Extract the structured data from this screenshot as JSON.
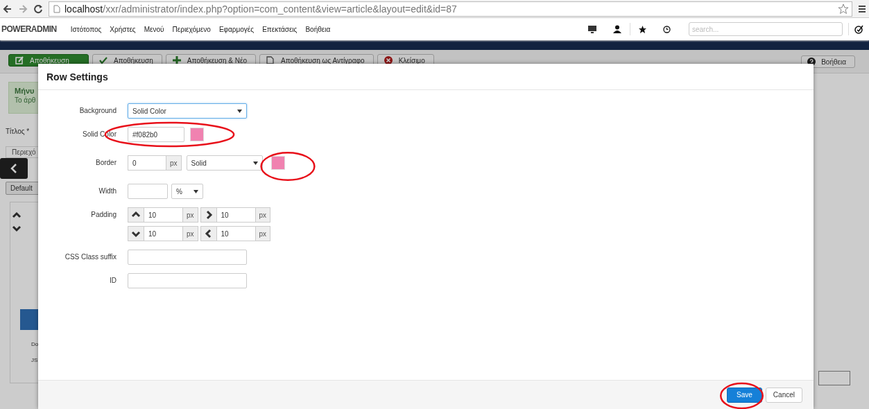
{
  "browser": {
    "url_host": "localhost",
    "url_path": "/xxr/administrator/index.php?option=com_content&view=article&layout=edit&id=87"
  },
  "admin_nav": {
    "brand": "POWERADMIN",
    "items": [
      "Ιστότοπος",
      "Χρήστες",
      "Μενού",
      "Περιεχόμενο",
      "Εφαρμογές",
      "Επεκτάσεις",
      "Βοήθεια"
    ],
    "search": {
      "placeholder": "search..."
    }
  },
  "toolbar": {
    "buttons": [
      {
        "label": "Αποθήκευση",
        "kind": "primary"
      },
      {
        "label": "Αποθήκευση",
        "kind": "default"
      },
      {
        "label": "Αποθήκευση & Νέο",
        "kind": "default"
      },
      {
        "label": "Αποθήκευση ως Αντίγραφο",
        "kind": "default"
      },
      {
        "label": "Κλείσιμο",
        "kind": "default"
      }
    ],
    "help": "Βοήθεια"
  },
  "page": {
    "message_title": "Μήνυ",
    "message_text": "Το άρθ",
    "title_label": "Τίτλος *",
    "tab": "Περιεχό",
    "default_button": "Default",
    "labels": [
      "Do",
      "JS"
    ]
  },
  "modal": {
    "title": "Row Settings",
    "fields": [
      {
        "kind": "select",
        "label": "Background",
        "value": "Solid Color",
        "focused": true
      },
      {
        "kind": "color",
        "label": "Solid Color",
        "value": "#f082b0",
        "highlighted": true
      },
      {
        "kind": "border",
        "label": "Border",
        "value": "0",
        "unit": "px",
        "style": "Solid",
        "swatch_highlighted": true
      },
      {
        "kind": "size",
        "label": "Width",
        "unit": "%"
      },
      {
        "kind": "padding",
        "label": "Padding",
        "sides": [
          {
            "value": "10",
            "unit": "px"
          },
          {
            "value": "10",
            "unit": "px"
          },
          {
            "value": "10",
            "unit": "px"
          },
          {
            "value": "10",
            "unit": "px"
          }
        ]
      },
      {
        "kind": "text",
        "label": "CSS Class suffix"
      },
      {
        "kind": "text",
        "label": "ID"
      }
    ],
    "buttons": [
      {
        "label": "Save",
        "kind": "primary",
        "highlighted": true
      },
      {
        "label": "Cancel",
        "kind": "default",
        "highlighted": false
      }
    ]
  }
}
